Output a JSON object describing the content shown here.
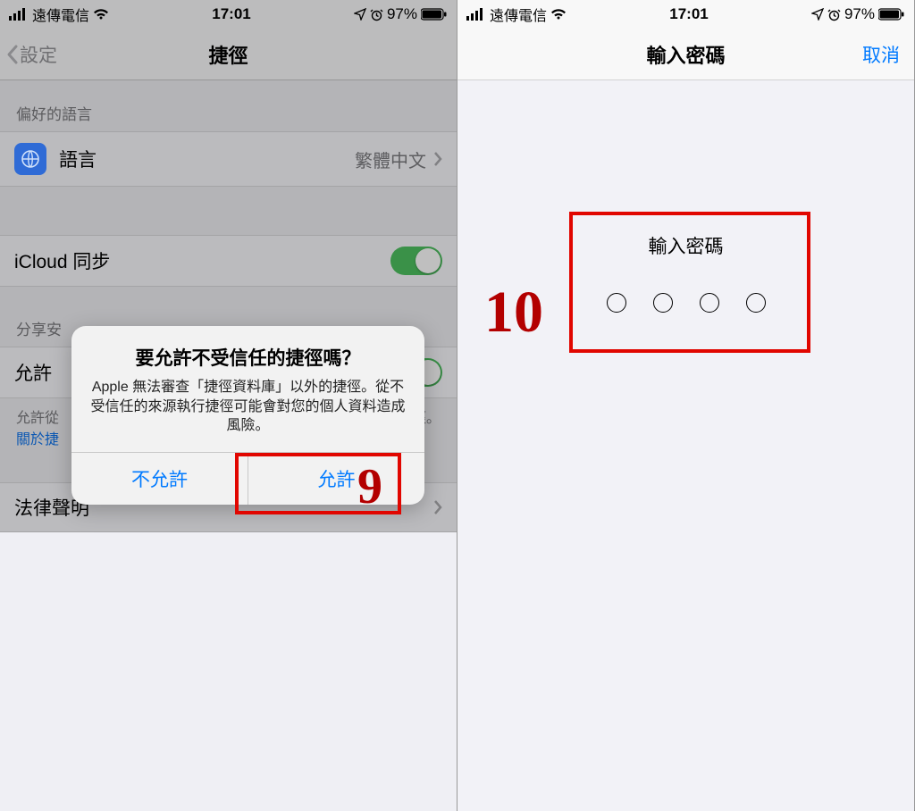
{
  "status": {
    "carrier": "遠傳電信",
    "time": "17:01",
    "battery": "97%"
  },
  "left": {
    "nav_back": "設定",
    "nav_title": "捷徑",
    "grp1_header": "偏好的語言",
    "language_label": "語言",
    "language_value": "繁體中文",
    "icloud_label": "iCloud 同步",
    "grp3_header": "分享安",
    "untrusted_label": "允許",
    "footer_text": "允許從",
    "footer_text_tail": "徑。",
    "footer_link": "關於捷",
    "legal_label": "法律聲明",
    "alert": {
      "title": "要允許不受信任的捷徑嗎？",
      "message": "Apple 無法審查「捷徑資料庫」以外的捷徑。從不受信任的來源執行捷徑可能會對您的個人資料造成風險。",
      "deny": "不允許",
      "allow": "允許"
    },
    "annotation_num": "9"
  },
  "right": {
    "nav_title": "輸入密碼",
    "cancel": "取消",
    "prompt": "輸入密碼",
    "annotation_num": "10"
  }
}
